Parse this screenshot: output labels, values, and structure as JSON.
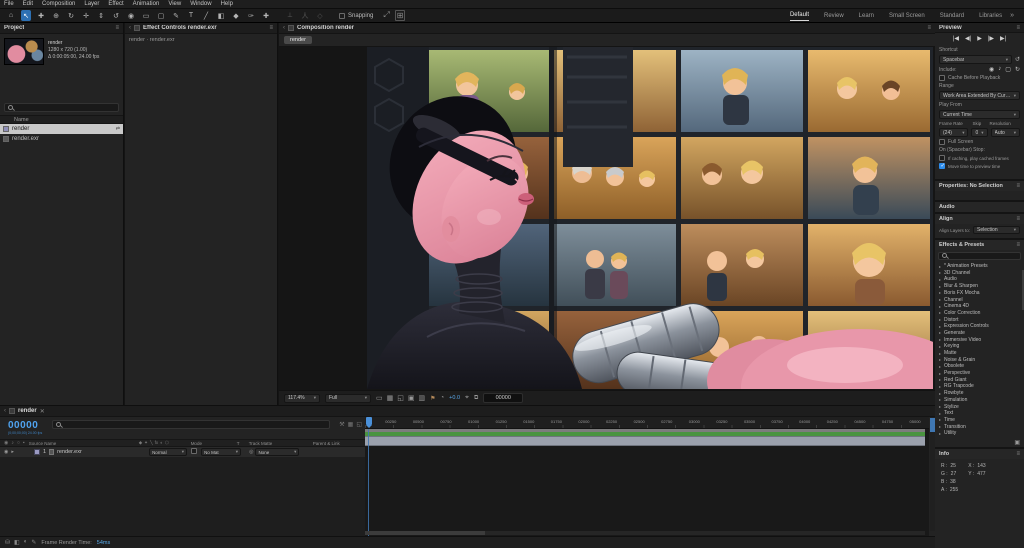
{
  "menu": {
    "items": [
      "File",
      "Edit",
      "Composition",
      "Layer",
      "Effect",
      "Animation",
      "View",
      "Window",
      "Help"
    ]
  },
  "toolbar": {
    "tools": [
      {
        "name": "home-icon",
        "glyph": "⌂"
      },
      {
        "name": "selection-tool-icon",
        "glyph": "↖",
        "active": true
      },
      {
        "name": "hand-tool-icon",
        "glyph": "✚"
      },
      {
        "name": "zoom-tool-icon",
        "glyph": "⊕"
      },
      {
        "name": "orbit-camera-icon",
        "glyph": "↻"
      },
      {
        "name": "pan-camera-icon",
        "glyph": "✛"
      },
      {
        "name": "dolly-camera-icon",
        "glyph": "⇕"
      },
      {
        "name": "rotation-tool-icon",
        "glyph": "↺"
      },
      {
        "name": "camera-tool-icon",
        "glyph": "◉"
      },
      {
        "name": "pan-behind-icon",
        "glyph": "▭"
      },
      {
        "name": "shape-tool-icon",
        "glyph": "▢"
      },
      {
        "name": "pen-tool-icon",
        "glyph": "✎"
      },
      {
        "name": "type-tool-icon",
        "glyph": "T"
      },
      {
        "name": "brush-tool-icon",
        "glyph": "╱"
      },
      {
        "name": "stamp-tool-icon",
        "glyph": "◧"
      },
      {
        "name": "eraser-tool-icon",
        "glyph": "◆"
      },
      {
        "name": "roto-brush-icon",
        "glyph": "✑"
      },
      {
        "name": "puppet-pin-icon",
        "glyph": "✚"
      }
    ],
    "dim_tools": [
      {
        "name": "local-axis-icon",
        "glyph": "⟂"
      },
      {
        "name": "world-axis-icon",
        "glyph": "人"
      },
      {
        "name": "view-axis-icon",
        "glyph": "◇"
      }
    ],
    "snapping_label": "Snapping",
    "right_tools": [
      {
        "name": "zoom-fit-icon",
        "glyph": "⤢"
      },
      {
        "name": "grid-options-icon",
        "glyph": "⊞",
        "boxed": true
      }
    ],
    "workspaces": [
      "Default",
      "Review",
      "Learn",
      "Small Screen",
      "Standard",
      "Libraries"
    ],
    "active_workspace": "Default",
    "overflow_glyph": "»"
  },
  "project": {
    "tab": "Project",
    "item_name": "render",
    "item_meta1": "1280 x 720 (1.00)",
    "item_meta2": "Δ 0:00:05:00, 24.00 fps",
    "name_header": "Name",
    "rows": [
      {
        "label": "render",
        "selected": true,
        "icon": "comp"
      },
      {
        "label": "render.exr",
        "selected": false,
        "icon": "file"
      }
    ]
  },
  "effect_controls": {
    "tab": "Effect Controls render.exr",
    "subtitle": "render · render.exr"
  },
  "composition": {
    "tab": "Composition render",
    "breadcrumb": "render",
    "zoom": "117.4%",
    "resolution": "Full",
    "view_icons": [
      {
        "name": "region-of-interest-icon",
        "glyph": "▭"
      },
      {
        "name": "transparency-grid-icon",
        "glyph": "▦"
      },
      {
        "name": "mask-visibility-icon",
        "glyph": "◱"
      },
      {
        "name": "view-layout-icon",
        "glyph": "▣"
      },
      {
        "name": "guides-icon",
        "glyph": "▥"
      }
    ],
    "flag_glyph": "⚑",
    "aperture_glyph": "◔",
    "exposure": "+0.0",
    "camera_glyph": "⌖",
    "pixel_aspect_glyph": "⧉",
    "timecode": "00000"
  },
  "preview": {
    "tab": "Preview",
    "transport": [
      {
        "name": "go-to-start-icon",
        "glyph": "|◀"
      },
      {
        "name": "previous-frame-icon",
        "glyph": "◀|"
      },
      {
        "name": "play-icon",
        "glyph": "▶"
      },
      {
        "name": "next-frame-icon",
        "glyph": "|▶"
      },
      {
        "name": "go-to-end-icon",
        "glyph": "▶|"
      }
    ],
    "shortcut_label": "Shortcut",
    "shortcut_value": "Spacebar",
    "reset_glyph": "↺",
    "include_label": "Include:",
    "include_icons": [
      {
        "name": "include-video-icon",
        "glyph": "◉"
      },
      {
        "name": "include-audio-icon",
        "glyph": "♪"
      },
      {
        "name": "include-overlays-icon",
        "glyph": "▢"
      },
      {
        "name": "loop-icon",
        "glyph": "↻"
      }
    ],
    "cache_label": "Cache Before Playback",
    "range_label": "Range",
    "range_value": "Work Area Extended By Current…",
    "play_from_label": "Play From",
    "play_from_value": "Current Time",
    "frame_rate_label": "Frame Rate",
    "frame_rate_value": "(24)",
    "skip_label": "Skip",
    "skip_value": "0",
    "resolution_label": "Resolution",
    "resolution_value": "Auto",
    "full_screen_label": "Full Screen",
    "on_stop_label": "On (Spacebar) Stop:",
    "opt1": "If caching, play cached frames",
    "opt2": "Move time to preview time"
  },
  "properties": {
    "tab": "Properties: No Selection"
  },
  "audio": {
    "tab": "Audio"
  },
  "align": {
    "tab": "Align",
    "layers_label": "Align Layers to:",
    "layers_value": "Selection"
  },
  "effects_presets": {
    "tab": "Effects & Presets",
    "categories": [
      "* Animation Presets",
      "3D Channel",
      "Audio",
      "Blur & Sharpen",
      "Boris FX Mocha",
      "Channel",
      "Cinema 4D",
      "Color Correction",
      "Distort",
      "Expression Controls",
      "Generate",
      "Immersive Video",
      "Keying",
      "Matte",
      "Noise & Grain",
      "Obsolete",
      "Perspective",
      "Red Giant",
      "RG Trapcode",
      "Rowbyte",
      "Simulation",
      "Stylize",
      "Text",
      "Time",
      "Transition",
      "Utility"
    ]
  },
  "info": {
    "tab": "Info",
    "channels": [
      [
        "R :",
        "25"
      ],
      [
        "G :",
        "27"
      ],
      [
        "B :",
        "38"
      ],
      [
        "A :",
        "255"
      ]
    ],
    "coords": [
      [
        "X :",
        "143"
      ],
      [
        "Y :",
        "477"
      ]
    ]
  },
  "timeline": {
    "tab": "render",
    "timecode": "00000",
    "timecode_sub": "(0;00;00;00)  24.00 fps",
    "columns": {
      "source_name": "Source Name",
      "mode": "Mode",
      "t": "T",
      "track_matte": "Track Matte",
      "parent": "Parent & Link"
    },
    "layer": {
      "number": "1",
      "name": "render.exr",
      "mode": "Normal",
      "track_matte": "No Mat",
      "parent": "None"
    },
    "ruler_labels": [
      "00250",
      "00500",
      "00750",
      "01000",
      "01250",
      "01500",
      "01750",
      "02000",
      "02250",
      "02500",
      "02750",
      "03000",
      "03250",
      "03500",
      "03750",
      "04000",
      "04250",
      "04500",
      "04750",
      "05000"
    ],
    "status": {
      "label": "Frame Render Time:",
      "value": "54ms"
    }
  },
  "colors": {
    "accent_blue": "#2d8ceb",
    "timecode_blue": "#4fa3f0",
    "cache_green": "#4a9440"
  }
}
